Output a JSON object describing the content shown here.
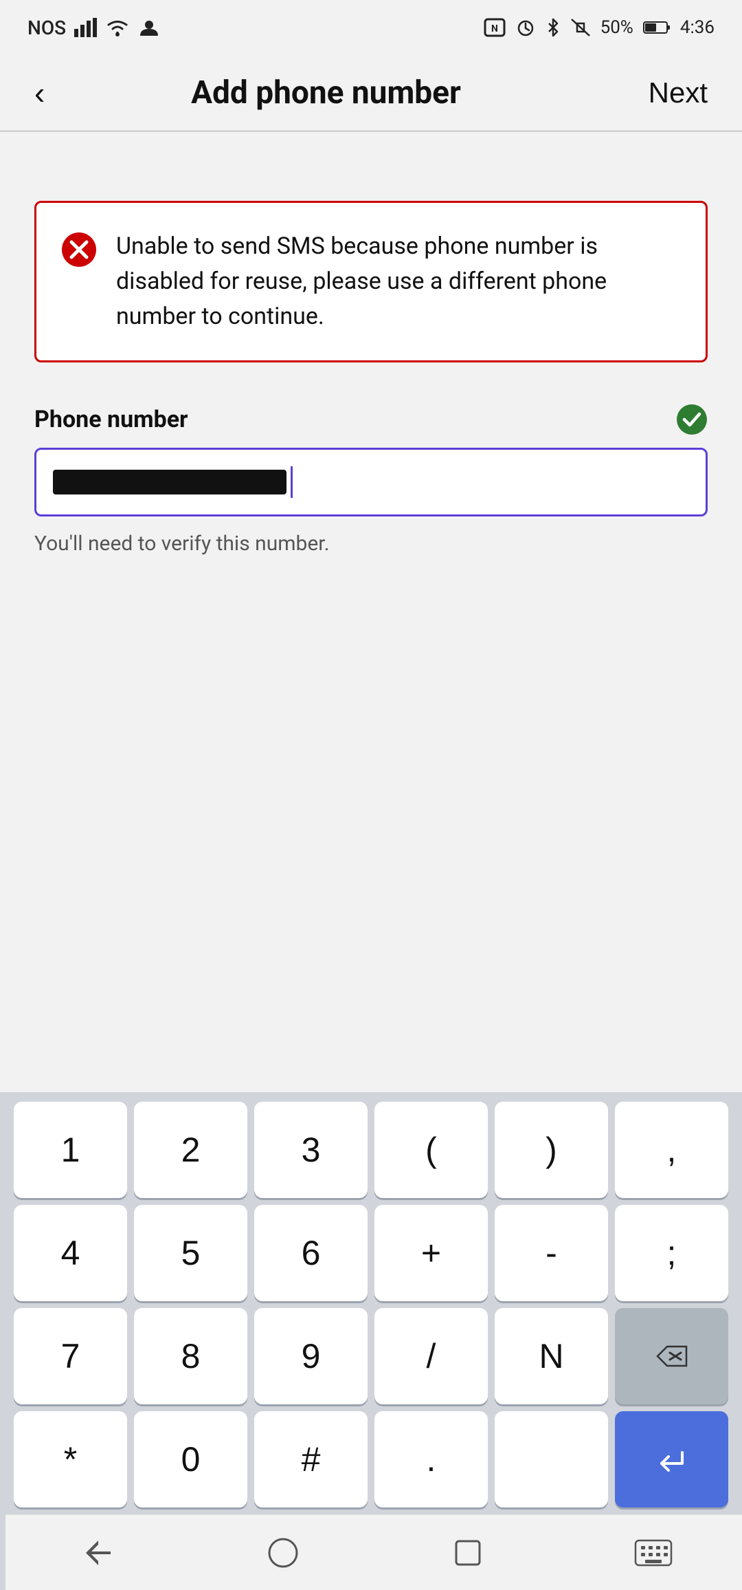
{
  "statusBar": {
    "carrier": "NOS",
    "time": "4:36",
    "battery": "50%"
  },
  "header": {
    "back_label": "‹",
    "title": "Add phone number",
    "next_label": "Next"
  },
  "errorBox": {
    "message": "Unable to send SMS because phone number is disabled for reuse, please use a different phone number to continue."
  },
  "phoneField": {
    "label": "Phone number",
    "hint": "You'll need to verify this number."
  },
  "keyboard": {
    "rows": [
      [
        "1",
        "2",
        "3",
        "(",
        ")",
        ","
      ],
      [
        "4",
        "5",
        "6",
        "+",
        "-",
        ";"
      ],
      [
        "7",
        "8",
        "9",
        "/",
        "N",
        "⌫"
      ],
      [
        "*",
        "0",
        "#",
        ".",
        "",
        "↵"
      ]
    ]
  },
  "navBar": {
    "back_icon": "▽",
    "home_icon": "○",
    "recents_icon": "□",
    "keyboard_icon": "⌨"
  }
}
